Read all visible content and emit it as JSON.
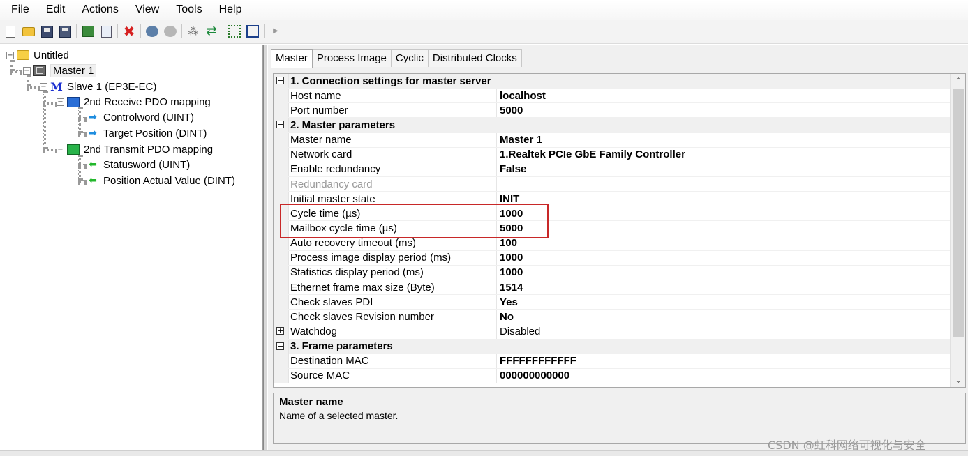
{
  "menu": [
    "File",
    "Edit",
    "Actions",
    "View",
    "Tools",
    "Help"
  ],
  "toolbar_icons": [
    "new-file-icon",
    "open-folder-icon",
    "save-icon",
    "save-all-icon",
    "export-icon",
    "import-icon",
    "delete-icon",
    "connect-icon",
    "disconnect-icon",
    "network-tree-icon",
    "swap-icon",
    "select-area-icon",
    "frame-icon",
    "more-arrow-icon"
  ],
  "tree": {
    "root": "Untitled",
    "master": "Master 1",
    "slave": "Slave 1 (EP3E-EC)",
    "rx_pdo": "2nd Receive PDO mapping",
    "rx_items": [
      "Controlword (UINT)",
      "Target Position (DINT)"
    ],
    "tx_pdo": "2nd Transmit PDO mapping",
    "tx_items": [
      "Statusword (UINT)",
      "Position Actual Value (DINT)"
    ]
  },
  "tabs": [
    "Master",
    "Process Image",
    "Cyclic",
    "Distributed Clocks"
  ],
  "grid": {
    "rows": [
      {
        "type": "cat",
        "expander": "⊟",
        "name": "1. Connection settings for master server"
      },
      {
        "name": "Host name",
        "value": "localhost"
      },
      {
        "name": "Port number",
        "value": "5000"
      },
      {
        "type": "cat",
        "expander": "⊟",
        "name": "2. Master parameters"
      },
      {
        "name": "Master name",
        "value": "Master 1"
      },
      {
        "name": "Network card",
        "value": "1.Realtek PCIe GbE Family Controller"
      },
      {
        "name": "Enable redundancy",
        "value": "False"
      },
      {
        "name": "Redundancy card",
        "value": "",
        "disabled": true
      },
      {
        "name": "Initial master state",
        "value": "INIT"
      },
      {
        "name": "Cycle time (µs)",
        "value": "1000"
      },
      {
        "name": "Mailbox cycle time (µs)",
        "value": "5000"
      },
      {
        "name": "Auto recovery timeout (ms)",
        "value": "100"
      },
      {
        "name": "Process image display period (ms)",
        "value": "1000"
      },
      {
        "name": "Statistics display period (ms)",
        "value": "1000"
      },
      {
        "name": "Ethernet frame max size (Byte)",
        "value": "1514"
      },
      {
        "name": "Check slaves PDI",
        "value": "Yes"
      },
      {
        "name": "Check slaves Revision number",
        "value": "No"
      },
      {
        "name": "Watchdog",
        "value": "Disabled",
        "expander": "⊞",
        "plain": true
      },
      {
        "type": "cat",
        "expander": "⊟",
        "name": "3. Frame parameters"
      },
      {
        "name": "Destination MAC",
        "value": "FFFFFFFFFFFF"
      },
      {
        "name": "Source MAC",
        "value": "000000000000"
      }
    ]
  },
  "help": {
    "title": "Master name",
    "description": "Name of a selected master."
  },
  "watermark": "CSDN @虹科网络可视化与安全",
  "colors": {
    "highlight": "#c82828",
    "category_bg": "#f0f0f0"
  }
}
